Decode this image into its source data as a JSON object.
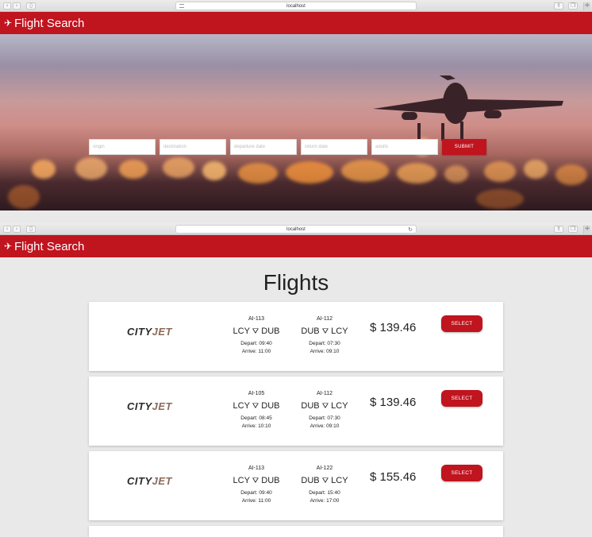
{
  "browser": {
    "url": "localhost"
  },
  "app": {
    "title": "Flight Search"
  },
  "search": {
    "origin_placeholder": "origin",
    "destination_placeholder": "destination",
    "departure_placeholder": "departure date",
    "return_placeholder": "return date",
    "adults_placeholder": "adults",
    "submit_label": "SUBMIT"
  },
  "results": {
    "heading": "Flights",
    "flights": [
      {
        "airline": "CITYJET",
        "outbound": {
          "code": "AI-113",
          "from": "LCY",
          "to": "DUB",
          "depart": "Depart: 09:40",
          "arrive": "Arrive: 11:00"
        },
        "inbound": {
          "code": "AI-112",
          "from": "DUB",
          "to": "LCY",
          "depart": "Depart: 07:30",
          "arrive": "Arrive: 09:10"
        },
        "price": "$ 139.46",
        "select_label": "SELECT"
      },
      {
        "airline": "CITYJET",
        "outbound": {
          "code": "AI-105",
          "from": "LCY",
          "to": "DUB",
          "depart": "Depart: 08:45",
          "arrive": "Arrive: 10:10"
        },
        "inbound": {
          "code": "AI-112",
          "from": "DUB",
          "to": "LCY",
          "depart": "Depart: 07:30",
          "arrive": "Arrive: 09:10"
        },
        "price": "$ 139.46",
        "select_label": "SELECT"
      },
      {
        "airline": "CITYJET",
        "outbound": {
          "code": "AI-113",
          "from": "LCY",
          "to": "DUB",
          "depart": "Depart: 09:40",
          "arrive": "Arrive: 11:00"
        },
        "inbound": {
          "code": "AI-122",
          "from": "DUB",
          "to": "LCY",
          "depart": "Depart: 15:40",
          "arrive": "Arrive: 17:00"
        },
        "price": "$ 155.46",
        "select_label": "SELECT"
      }
    ]
  },
  "colors": {
    "brand_red": "#c0141f",
    "background": "#e9e9e9"
  },
  "icons": {
    "app": "airplane-icon",
    "route": "plane-departure-icon"
  }
}
